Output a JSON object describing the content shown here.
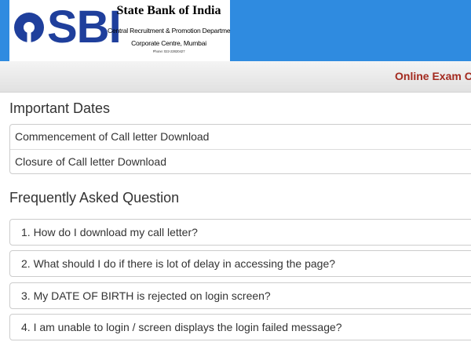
{
  "header": {
    "logo_text": "SBI",
    "bank_name": "State Bank of India",
    "department": "Central Recruitment & Promotion Department",
    "office": "Corporate Centre, Mumbai",
    "phone": "Phone: 022-22820427",
    "brand_color": "#2f8be0"
  },
  "nav": {
    "title": "Online Exam C"
  },
  "important_dates": {
    "title": "Important Dates",
    "rows": [
      "Commencement of Call letter Download",
      "Closure of Call letter Download"
    ]
  },
  "faq": {
    "title": "Frequently Asked Question",
    "items": [
      "1. How do I download my call letter?",
      "2. What should I do if there is lot of delay in accessing the page?",
      "3. My DATE OF BIRTH is rejected on login screen?",
      "4. I am unable to login / screen displays the login failed message?"
    ]
  }
}
